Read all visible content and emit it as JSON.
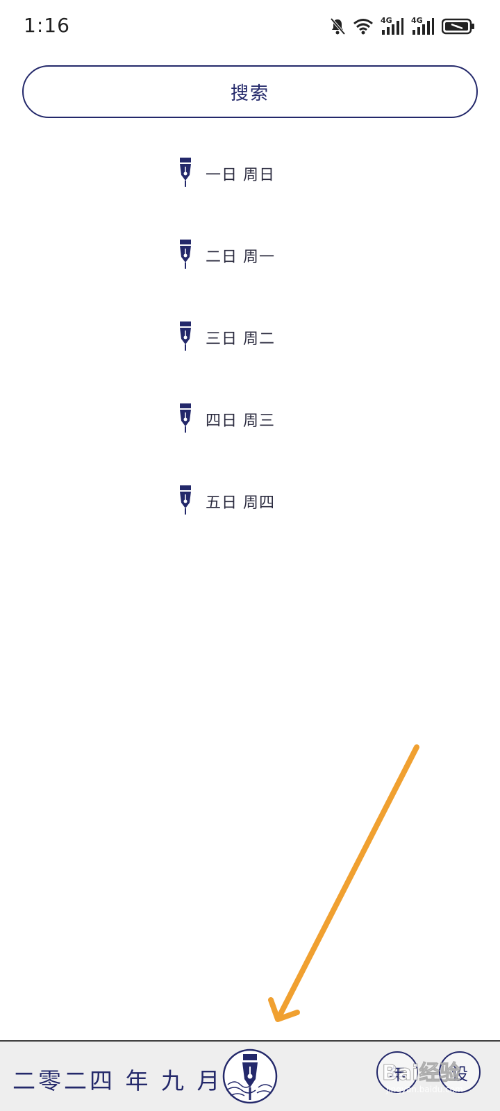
{
  "status_bar": {
    "time": "1:16",
    "icons": [
      "mute-bell-icon",
      "wifi-icon",
      "4g-signal-icon",
      "4g-signal-icon",
      "battery-charging-icon"
    ],
    "network_label_1": "4G",
    "network_label_2": "4G"
  },
  "search": {
    "label": "搜索"
  },
  "entries": [
    {
      "icon": "fountain-pen-icon",
      "label": "一日 周日"
    },
    {
      "icon": "fountain-pen-icon",
      "label": "二日 周一"
    },
    {
      "icon": "fountain-pen-icon",
      "label": "三日 周二"
    },
    {
      "icon": "fountain-pen-icon",
      "label": "四日 周三"
    },
    {
      "icon": "fountain-pen-icon",
      "label": "五日 周四"
    }
  ],
  "bottom_bar": {
    "month": "二零二四 年 九 月",
    "fab_icon": "fountain-pen-emblem-icon",
    "year_button": "年",
    "settings_button": "设"
  },
  "watermark": {
    "text": "Bai经验",
    "url": "jingyan.baidu.com"
  },
  "colors": {
    "accent": "#23286a",
    "background": "#ffffff",
    "bottom_bar": "#eeeeee",
    "annotation_arrow": "#f0a030"
  }
}
